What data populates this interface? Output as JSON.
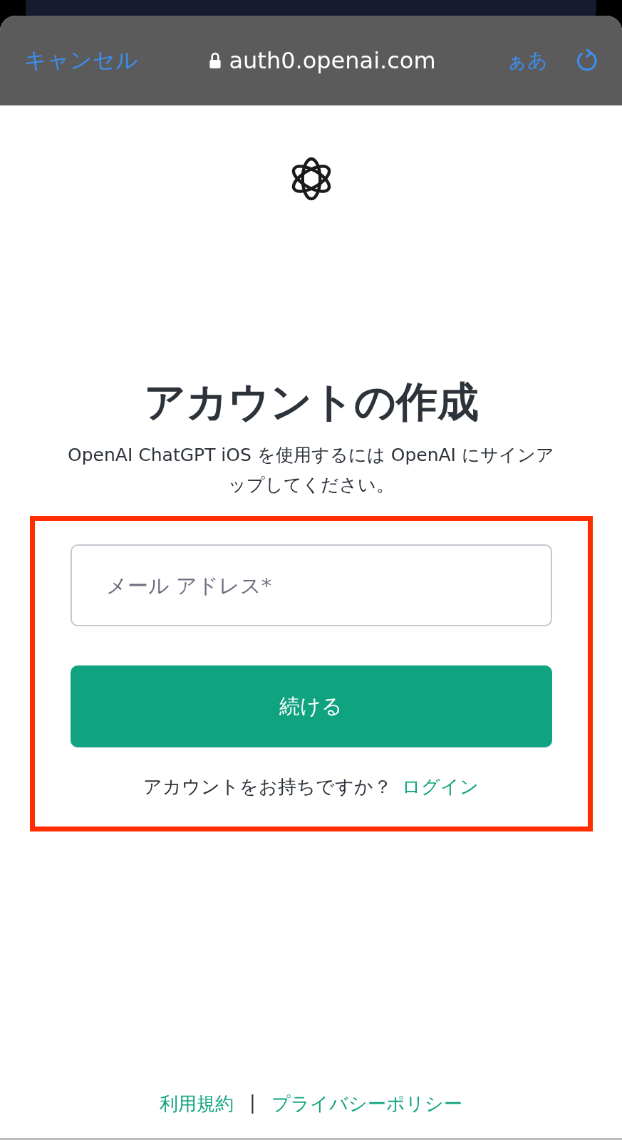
{
  "browser_bar": {
    "cancel": "キャンセル",
    "url": "auth0.openai.com",
    "text_size": "ぁあ"
  },
  "heading": "アカウントの作成",
  "subtitle": "OpenAI ChatGPT iOS を使用するには OpenAI にサインアップしてください。",
  "email_field": {
    "placeholder": "メール アドレス*"
  },
  "continue_button": "続ける",
  "login_prompt": {
    "text": "アカウントをお持ちですか？",
    "link": "ログイン"
  },
  "footer": {
    "links": [
      "利用規約",
      "プライバシーポリシー"
    ],
    "separator": "|"
  }
}
